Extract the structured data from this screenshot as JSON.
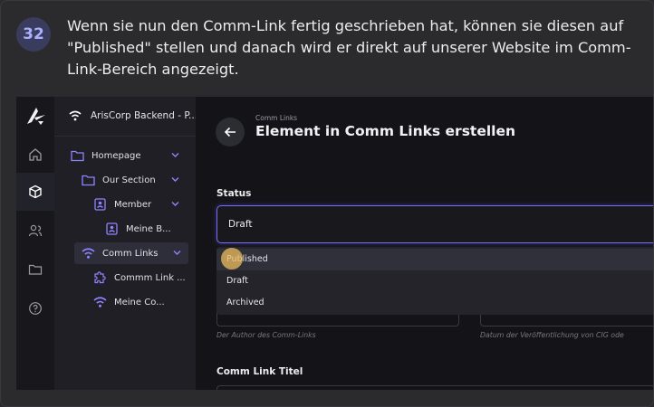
{
  "step": {
    "number": "32",
    "text": "Wenn sie nun den Comm-Link fertig geschrieben hat, können sie diesen auf \"Published\" stellen und danach wird er direkt auf unserer Website im Comm-Link-Bereich angezeigt."
  },
  "sidebar_rail": {
    "icons": [
      "logo-icon",
      "home-icon",
      "cube-icon",
      "users-icon",
      "folder-icon",
      "help-icon"
    ],
    "active": "cube-icon"
  },
  "tree": {
    "header_title": "ArisCorp Backend - P...",
    "items": [
      {
        "label": "Homepage",
        "icon": "folder-icon"
      },
      {
        "label": "Our Section",
        "icon": "folder-icon"
      },
      {
        "label": "Member",
        "icon": "badge-icon"
      },
      {
        "label": "Meine B...",
        "icon": "badge-icon"
      },
      {
        "label": "Comm Links",
        "icon": "wifi-icon"
      },
      {
        "label": "Commm Link ...",
        "icon": "puzzle-icon"
      },
      {
        "label": "Meine Co...",
        "icon": "wifi-icon"
      }
    ]
  },
  "main": {
    "breadcrumb": "Comm Links",
    "title": "Element in Comm Links erstellen",
    "status_label": "Status",
    "status_value": "Draft",
    "options": [
      "Published",
      "Draft",
      "Archived"
    ],
    "author_hint": "Der Author des Comm-Links",
    "date_hint": "Datum der Veröffentlichung von CIG ode",
    "titel_label": "Comm Link Titel"
  },
  "colors": {
    "accent": "#7a6bff",
    "badge_bg": "#3a3c5e",
    "badge_text": "#a9b0ff",
    "cursor": "#ebbe5f"
  }
}
